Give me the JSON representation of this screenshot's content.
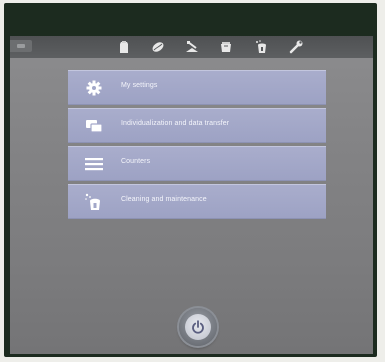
{
  "toolbar": {
    "icons": [
      "bag-icon",
      "coffee-bean-icon",
      "ground-coffee-icon",
      "milk-container-icon",
      "cleaning-icon",
      "wrench-icon"
    ]
  },
  "menu": {
    "items": [
      {
        "label": "My settings",
        "icon": "gear-icon"
      },
      {
        "label": "Individualization and data transfer",
        "icon": "data-transfer-icon"
      },
      {
        "label": "Counters",
        "icon": "menu-lines-icon"
      },
      {
        "label": "Cleaning and maintenance",
        "icon": "cleaning-icon"
      }
    ]
  },
  "power": {
    "icon": "power-icon"
  },
  "colors": {
    "menu_item": "#a3a8c9",
    "background": "#848486",
    "topbar": "#56585a"
  }
}
